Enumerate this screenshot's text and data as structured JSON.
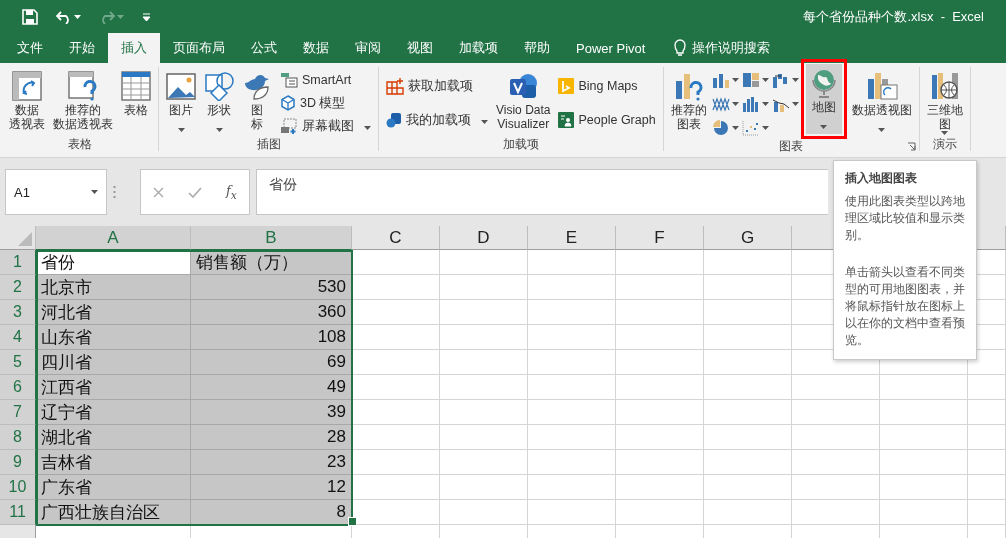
{
  "window": {
    "title": "每个省份品种个数.xlsx  -  Excel"
  },
  "tabs": [
    {
      "label": "文件",
      "selected": false
    },
    {
      "label": "开始",
      "selected": false
    },
    {
      "label": "插入",
      "selected": true
    },
    {
      "label": "页面布局",
      "selected": false
    },
    {
      "label": "公式",
      "selected": false
    },
    {
      "label": "数据",
      "selected": false
    },
    {
      "label": "审阅",
      "selected": false
    },
    {
      "label": "视图",
      "selected": false
    },
    {
      "label": "加载项",
      "selected": false
    },
    {
      "label": "帮助",
      "selected": false
    },
    {
      "label": "Power Pivot",
      "selected": false
    }
  ],
  "tell_me": "操作说明搜索",
  "ribbon": {
    "groups": [
      {
        "label": "表格",
        "items": [
          {
            "kind": "large",
            "label": [
              "数据",
              "透视表"
            ],
            "dropdown": false,
            "hovered": false
          },
          {
            "kind": "large",
            "label": [
              "推荐的",
              "数据透视表"
            ],
            "dropdown": false,
            "hovered": false
          },
          {
            "kind": "large",
            "label": [
              "表格"
            ],
            "dropdown": false,
            "hovered": false
          }
        ]
      },
      {
        "label": "插图",
        "items": [
          {
            "kind": "large",
            "label": [
              "图片"
            ],
            "dropdown": true,
            "hovered": false
          },
          {
            "kind": "large",
            "label": [
              "形状"
            ],
            "dropdown": true,
            "hovered": false
          },
          {
            "kind": "large",
            "label": [
              "图",
              "标"
            ],
            "dropdown": false,
            "hovered": false
          },
          {
            "kind": "stack",
            "items": [
              {
                "label": "SmartArt",
                "dropdown": false
              },
              {
                "label": "3D 模型",
                "dropdown": false
              },
              {
                "label": "屏幕截图",
                "dropdown": true
              }
            ]
          }
        ]
      },
      {
        "label": "加载项",
        "items": [
          {
            "kind": "stack",
            "items": [
              {
                "label": "获取加载项",
                "dropdown": false
              },
              {
                "label": "我的加载项",
                "dropdown": true
              }
            ]
          },
          {
            "kind": "large",
            "label": [
              "Visio Data",
              "Visualizer"
            ],
            "dropdown": false,
            "hovered": false
          },
          {
            "kind": "stack",
            "items": [
              {
                "label": "Bing Maps",
                "dropdown": false
              },
              {
                "label": "People Graph",
                "dropdown": false
              }
            ]
          }
        ]
      },
      {
        "label": "图表",
        "items": [
          {
            "kind": "large",
            "label": [
              "推荐的",
              "图表"
            ],
            "dropdown": false,
            "hovered": false
          },
          {
            "kind": "gallery"
          },
          {
            "kind": "large",
            "label": [
              "地图"
            ],
            "dropdown": true,
            "hovered": true
          },
          {
            "kind": "large",
            "label": [
              "数据透视图"
            ],
            "dropdown": true,
            "hovered": false
          }
        ]
      },
      {
        "label": "演示",
        "items": [
          {
            "kind": "large",
            "label": [
              "三维地",
              "图"
            ],
            "dropdown": true,
            "hovered": false
          }
        ]
      }
    ]
  },
  "formula_bar": {
    "name_box": "A1",
    "function_label": "f$_{x}$",
    "formula": "省份"
  },
  "tooltip": {
    "title": "插入地图图表",
    "paragraphs": [
      "使用此图表类型以跨地理区域比较值和显示类别。",
      "单击箭头以查看不同类型的可用地图图表，并将鼠标指针放在图标上以在你的文档中查看预览。"
    ]
  },
  "sheet": {
    "columns": [
      {
        "label": "A",
        "selected": true
      },
      {
        "label": "B",
        "selected": true
      },
      {
        "label": "C",
        "selected": false
      },
      {
        "label": "D",
        "selected": false
      },
      {
        "label": "E",
        "selected": false
      },
      {
        "label": "F",
        "selected": false
      },
      {
        "label": "G",
        "selected": false
      }
    ],
    "rows": [
      {
        "label": "1",
        "selected": true,
        "cells": [
          {
            "value": "省份",
            "kind": "text",
            "active": true
          },
          {
            "value": "销售额（万）",
            "kind": "text",
            "active": false
          }
        ]
      },
      {
        "label": "2",
        "selected": true,
        "cells": [
          {
            "value": "北京市",
            "kind": "text",
            "active": false
          },
          {
            "value": "530",
            "kind": "number",
            "active": false
          }
        ]
      },
      {
        "label": "3",
        "selected": true,
        "cells": [
          {
            "value": "河北省",
            "kind": "text",
            "active": false
          },
          {
            "value": "360",
            "kind": "number",
            "active": false
          }
        ]
      },
      {
        "label": "4",
        "selected": true,
        "cells": [
          {
            "value": "山东省",
            "kind": "text",
            "active": false
          },
          {
            "value": "108",
            "kind": "number",
            "active": false
          }
        ]
      },
      {
        "label": "5",
        "selected": true,
        "cells": [
          {
            "value": "四川省",
            "kind": "text",
            "active": false
          },
          {
            "value": "69",
            "kind": "number",
            "active": false
          }
        ]
      },
      {
        "label": "6",
        "selected": true,
        "cells": [
          {
            "value": "江西省",
            "kind": "text",
            "active": false
          },
          {
            "value": "49",
            "kind": "number",
            "active": false
          }
        ]
      },
      {
        "label": "7",
        "selected": true,
        "cells": [
          {
            "value": "辽宁省",
            "kind": "text",
            "active": false
          },
          {
            "value": "39",
            "kind": "number",
            "active": false
          }
        ]
      },
      {
        "label": "8",
        "selected": true,
        "cells": [
          {
            "value": "湖北省",
            "kind": "text",
            "active": false
          },
          {
            "value": "28",
            "kind": "number",
            "active": false
          }
        ]
      },
      {
        "label": "9",
        "selected": true,
        "cells": [
          {
            "value": "吉林省",
            "kind": "text",
            "active": false
          },
          {
            "value": "23",
            "kind": "number",
            "active": false
          }
        ]
      },
      {
        "label": "10",
        "selected": true,
        "cells": [
          {
            "value": "广东省",
            "kind": "text",
            "active": false
          },
          {
            "value": "12",
            "kind": "number",
            "active": false
          }
        ]
      },
      {
        "label": "11",
        "selected": true,
        "cells": [
          {
            "value": "广西壮族自治区",
            "kind": "text",
            "active": false
          },
          {
            "value": "8",
            "kind": "number",
            "active": false
          }
        ]
      }
    ]
  }
}
